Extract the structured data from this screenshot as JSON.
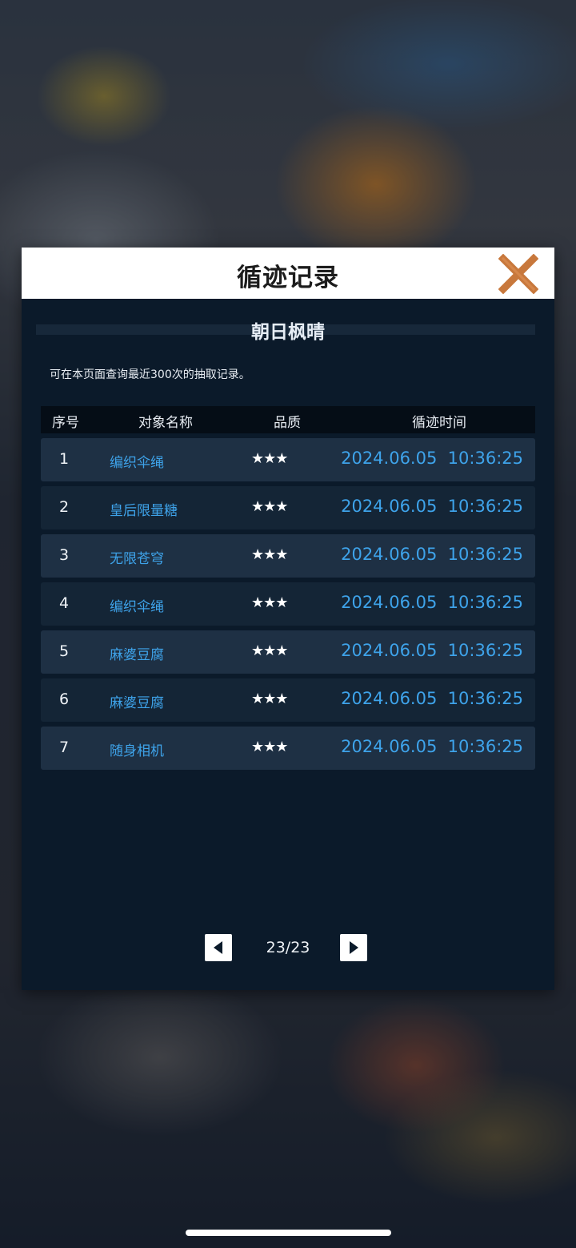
{
  "dialog": {
    "title": "循迹记录",
    "close_icon": "close-x-icon",
    "subtitle": "朝日枫晴",
    "notice": "可在本页面查询最近300次的抽取记录。"
  },
  "table": {
    "headers": {
      "index": "序号",
      "name": "对象名称",
      "quality": "品质",
      "time": "循迹时间"
    },
    "rows": [
      {
        "index": "1",
        "name": "编织伞绳",
        "stars": "★★★",
        "time": "2024.06.05  10:36:25"
      },
      {
        "index": "2",
        "name": "皇后限量糖",
        "stars": "★★★",
        "time": "2024.06.05  10:36:25"
      },
      {
        "index": "3",
        "name": "无限苍穹",
        "stars": "★★★",
        "time": "2024.06.05  10:36:25"
      },
      {
        "index": "4",
        "name": "编织伞绳",
        "stars": "★★★",
        "time": "2024.06.05  10:36:25"
      },
      {
        "index": "5",
        "name": "麻婆豆腐",
        "stars": "★★★",
        "time": "2024.06.05  10:36:25"
      },
      {
        "index": "6",
        "name": "麻婆豆腐",
        "stars": "★★★",
        "time": "2024.06.05  10:36:25"
      },
      {
        "index": "7",
        "name": "随身相机",
        "stars": "★★★",
        "time": "2024.06.05  10:36:25"
      }
    ]
  },
  "pager": {
    "label": "23/23",
    "prev_icon": "triangle-left-icon",
    "next_icon": "triangle-right-icon"
  },
  "colors": {
    "accent": "#3ea3ea",
    "close": "#c8783c",
    "panel": "#0b1a2a"
  }
}
